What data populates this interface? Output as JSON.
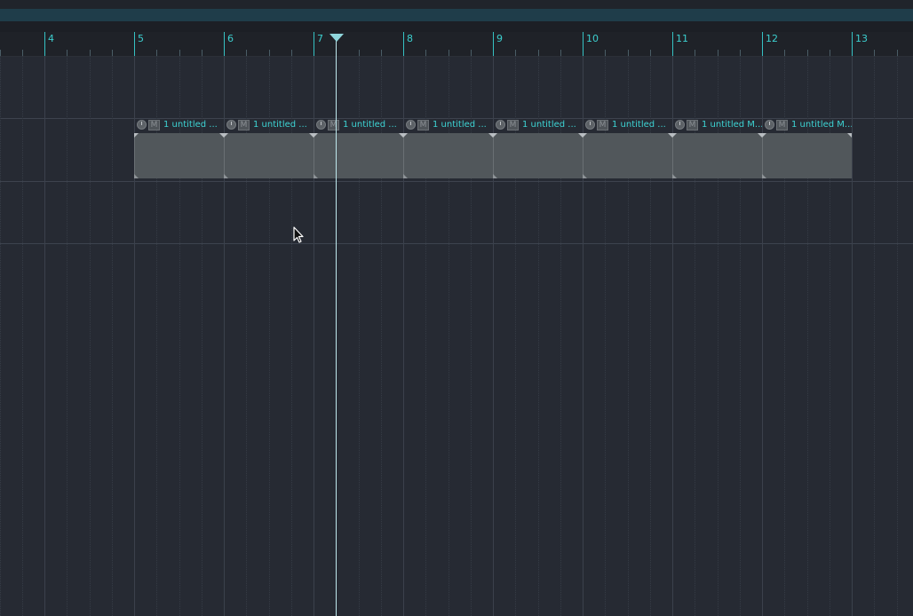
{
  "ruler": {
    "bars": [
      "4",
      "5",
      "6",
      "7",
      "8",
      "9",
      "10",
      "11",
      "12",
      "13"
    ]
  },
  "clips": [
    {
      "name": "1 untitled ...",
      "mute_label": "M"
    },
    {
      "name": "1 untitled ...",
      "mute_label": "M"
    },
    {
      "name": "1 untitled ...",
      "mute_label": "M"
    },
    {
      "name": "1 untitled ...",
      "mute_label": "M"
    },
    {
      "name": "1 untitled ...",
      "mute_label": "M"
    },
    {
      "name": "1 untitled ...",
      "mute_label": "M"
    },
    {
      "name": "1 untitled M...",
      "mute_label": "M"
    },
    {
      "name": "1 untitled M...",
      "mute_label": "M"
    }
  ],
  "colors": {
    "accent": "#3ccfcf",
    "clip_body": "#51575b",
    "background": "#262a33"
  },
  "icons": {
    "playhead": "playhead-marker-icon",
    "cursor": "mouse-pointer-icon"
  }
}
